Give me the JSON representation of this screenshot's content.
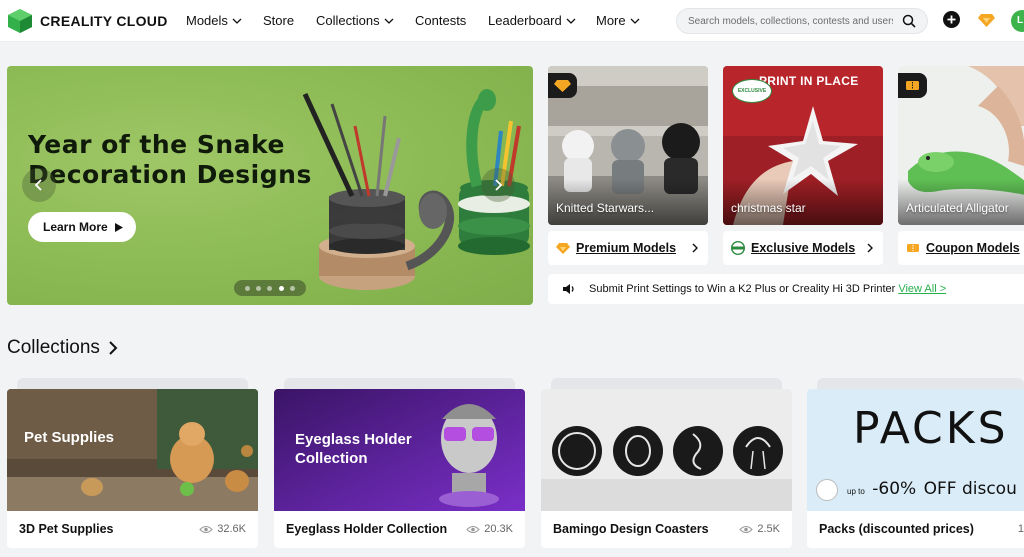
{
  "brand": {
    "name": "CREALITY CLOUD"
  },
  "nav": [
    {
      "label": "Models",
      "has_dropdown": true
    },
    {
      "label": "Store",
      "has_dropdown": false
    },
    {
      "label": "Collections",
      "has_dropdown": true
    },
    {
      "label": "Contests",
      "has_dropdown": false
    },
    {
      "label": "Leaderboard",
      "has_dropdown": true
    },
    {
      "label": "More",
      "has_dropdown": true
    }
  ],
  "search": {
    "placeholder": "Search models, collections, contests and users"
  },
  "user": {
    "avatar_initial": "L"
  },
  "hero": {
    "title_line1": "Year of the Snake",
    "title_line2": "Decoration Designs",
    "button_label": "Learn More",
    "slide_count": 5,
    "active_slide": 4
  },
  "featured_models": [
    {
      "label": "Knitted Starwars...",
      "badge": "premium-badge-icon"
    },
    {
      "label": "christmas star",
      "overlay_text": "PRINT IN PLACE",
      "tag": "EXCLUSIVE"
    },
    {
      "label": "Articulated Alligator",
      "badge": "coupon-badge-icon"
    }
  ],
  "categories": [
    {
      "label": "Premium Models",
      "icon": "premium-diamond-icon"
    },
    {
      "label": "Exclusive Models",
      "icon": "exclusive-badge-icon"
    },
    {
      "label": "Coupon Models",
      "icon": "coupon-ticket-icon"
    }
  ],
  "notice": {
    "text": "Submit Print Settings to Win a K2 Plus or Creality Hi 3D Printer",
    "link": "View All >"
  },
  "collections_section": {
    "title": "Collections"
  },
  "collections": [
    {
      "name": "3D Pet Supplies",
      "views": "32.6K",
      "image_title": "Pet Supplies"
    },
    {
      "name": "Eyeglass Holder Collection",
      "views": "20.3K",
      "image_title_line1": "Eyeglass Holder",
      "image_title_line2": "Collection"
    },
    {
      "name": "Bamingo Design Coasters",
      "views": "2.5K"
    },
    {
      "name": "Packs (discounted prices)",
      "views": "1",
      "image_big": "PACKS",
      "image_sub_prefix": "up to",
      "image_sub_value": "-60%",
      "image_sub_suffix": "OFF discou"
    }
  ],
  "colors": {
    "accent_green": "#27ae4d",
    "brand_green": "#3cb44b",
    "premium_gold": "#f5a623"
  }
}
